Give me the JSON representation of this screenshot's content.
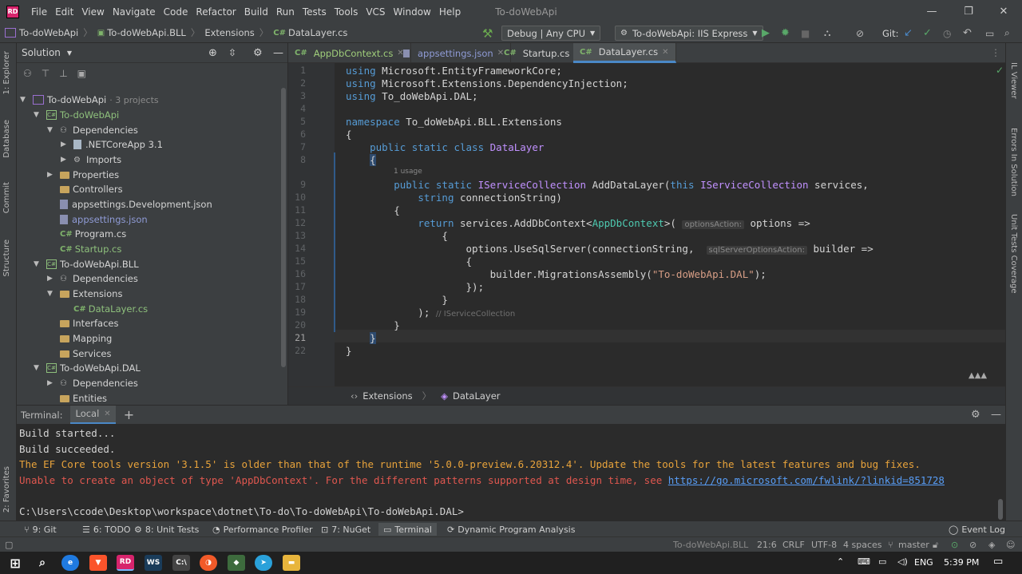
{
  "window": {
    "title": "To-doWebApi",
    "menu": [
      "File",
      "Edit",
      "View",
      "Navigate",
      "Code",
      "Refactor",
      "Build",
      "Run",
      "Tests",
      "Tools",
      "VCS",
      "Window",
      "Help"
    ]
  },
  "navbar": {
    "breadcrumb": [
      "To-doWebApi",
      "To-doWebApi.BLL",
      "Extensions",
      "DataLayer.cs"
    ],
    "config": "Debug | Any CPU",
    "run_target": "To-doWebApi: IIS Express",
    "git_label": "Git:"
  },
  "solution": {
    "header": "Solution",
    "tree": [
      {
        "label": "To-doWebApi",
        "extra": "· 3 projects",
        "kind": "solution"
      },
      {
        "label": "To-doWebApi",
        "kind": "project"
      },
      {
        "label": "Dependencies",
        "kind": "deps"
      },
      {
        "label": ".NETCoreApp 3.1",
        "kind": "file"
      },
      {
        "label": "Imports",
        "kind": "gear"
      },
      {
        "label": "Properties",
        "kind": "folder"
      },
      {
        "label": "Controllers",
        "kind": "folder"
      },
      {
        "label": "appsettings.Development.json",
        "kind": "json"
      },
      {
        "label": "appsettings.json",
        "kind": "json"
      },
      {
        "label": "Program.cs",
        "kind": "cs"
      },
      {
        "label": "Startup.cs",
        "kind": "cs"
      },
      {
        "label": "To-doWebApi.BLL",
        "kind": "project"
      },
      {
        "label": "Dependencies",
        "kind": "deps"
      },
      {
        "label": "Extensions",
        "kind": "folder"
      },
      {
        "label": "DataLayer.cs",
        "kind": "cs"
      },
      {
        "label": "Interfaces",
        "kind": "folder"
      },
      {
        "label": "Mapping",
        "kind": "folder"
      },
      {
        "label": "Services",
        "kind": "folder"
      },
      {
        "label": "To-doWebApi.DAL",
        "kind": "project"
      },
      {
        "label": "Dependencies",
        "kind": "deps"
      },
      {
        "label": "Entities",
        "kind": "folder"
      }
    ]
  },
  "editor": {
    "tabs": [
      {
        "label": "AppDbContext.cs",
        "icon": "C#"
      },
      {
        "label": "appsettings.json",
        "icon": "json"
      },
      {
        "label": "Startup.cs",
        "icon": "C#"
      },
      {
        "label": "DataLayer.cs",
        "icon": "C#"
      }
    ],
    "usage_hint": "1 usage",
    "hints": {
      "optionsAction": "optionsAction:",
      "sqlServerOptionsAction": "sqlServerOptionsAction:",
      "iservice": "// IServiceCollection"
    },
    "breadcrumb": [
      "Extensions",
      "DataLayer"
    ]
  },
  "terminal": {
    "label": "Terminal:",
    "tab": "Local",
    "lines": [
      {
        "text": "Build started...",
        "color": "#d4d4d4"
      },
      {
        "text": "Build succeeded.",
        "color": "#d4d4d4"
      },
      {
        "text": "The EF Core tools version '3.1.5' is older than that of the runtime '5.0.0-preview.6.20312.4'. Update the tools for the latest features and bug fixes.",
        "color": "#e8a33b"
      },
      {
        "text": "Unable to create an object of type 'AppDbContext'. For the different patterns supported at design time, see ",
        "color": "#e0574f"
      },
      {
        "text": "",
        "color": "#d4d4d4"
      },
      {
        "text": "C:\\Users\\ccode\\Desktop\\workspace\\dotnet\\To-do\\To-doWebApi\\To-doWebApi.DAL>",
        "color": "#d4d4d4"
      }
    ],
    "link": "https://go.microsoft.com/fwlink/?linkid=851728"
  },
  "bottom_tabs": [
    "9: Git",
    "6: TODO",
    "8: Unit Tests",
    "Performance Profiler",
    "7: NuGet",
    "Terminal",
    "Dynamic Program Analysis"
  ],
  "event_log": "Event Log",
  "status": {
    "project": "To-doWebApi.BLL",
    "position": "21:6",
    "line_sep": "CRLF",
    "encoding": "UTF-8",
    "indent": "4 spaces",
    "branch": "master"
  },
  "left_tabs": [
    "1: Explorer",
    "Database",
    "Commit",
    "Structure",
    "2: Favorites"
  ],
  "right_tabs": [
    "IL Viewer",
    "Errors In Solution",
    "Unit Tests Coverage"
  ],
  "taskbar": {
    "lang": "ENG",
    "time": "5:39 PM"
  },
  "colors": {
    "accent": "#4a88c7",
    "warning": "#e8a33b",
    "error": "#e0574f",
    "keyword": "#569cd6"
  }
}
